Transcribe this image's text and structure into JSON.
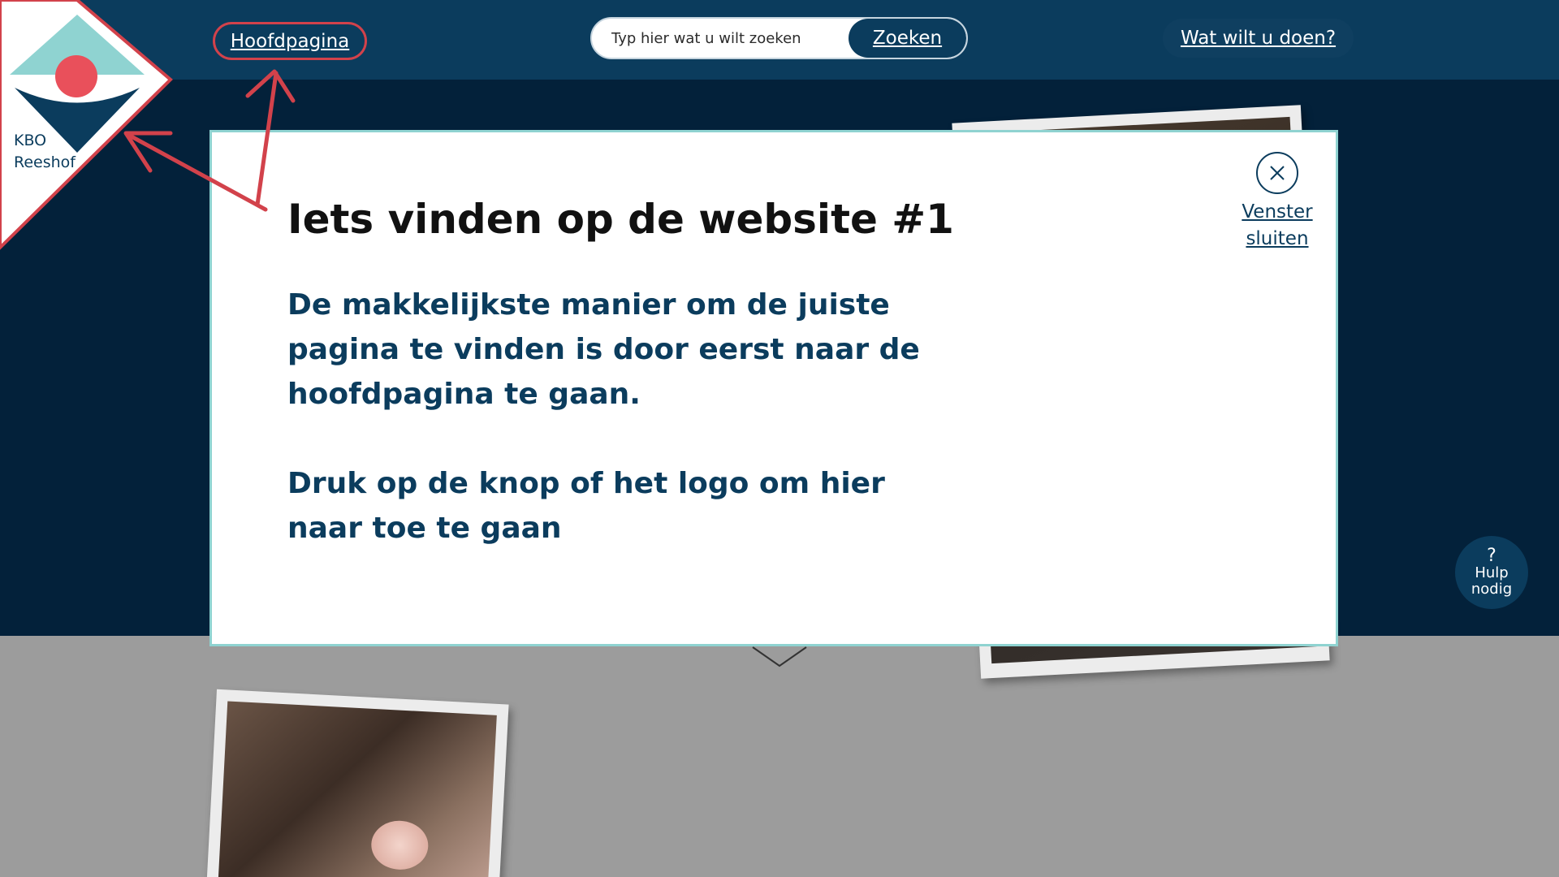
{
  "header": {
    "home_label": "Hoofdpagina",
    "search_placeholder": "Typ hier wat u wilt zoeken",
    "search_button": "Zoeken",
    "action_label": "Wat wilt u doen?"
  },
  "logo": {
    "line1": "KBO",
    "line2": "Reeshof"
  },
  "modal": {
    "title": "Iets vinden op de website #1",
    "paragraph1": "De makkelijkste manier om de juiste pagina te vinden is door eerst naar de hoofdpagina te gaan.",
    "paragraph2": "Druk op de knop of het logo om hier naar toe te gaan",
    "close_line1": "Venster",
    "close_line2": "sluiten"
  },
  "help": {
    "symbol": "?",
    "line1": "Hulp",
    "line2": "nodig"
  },
  "colors": {
    "navy": "#0b3c5d",
    "accent_red": "#d2424b",
    "teal": "#8fd3d1",
    "dark_bg": "#03213a"
  },
  "icons": [
    "close-icon",
    "scroll-down-chevron-icon",
    "annotation-arrow-icon"
  ]
}
